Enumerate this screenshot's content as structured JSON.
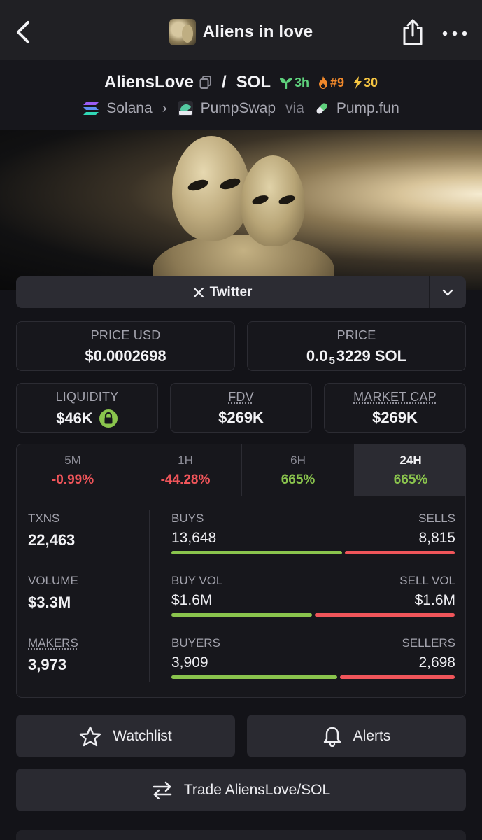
{
  "nav": {
    "title": "Aliens in love",
    "back_icon": "chevron-left-icon",
    "share_icon": "share-icon",
    "more_icon": "more-dots-icon"
  },
  "pair": {
    "base": "AliensLove",
    "slash": "/",
    "quote": "SOL",
    "age": "3h",
    "rank": "#9",
    "boosts": "30",
    "chain": "Solana",
    "dex": "PumpSwap",
    "via": "via",
    "launchpad": "Pump.fun"
  },
  "links": {
    "twitter_label": "Twitter"
  },
  "prices": {
    "price_usd_label": "PRICE USD",
    "price_usd": "$0.0002698",
    "price_label": "PRICE",
    "price_native_prefix": "0.0",
    "price_native_zeros": "5",
    "price_native_suffix": "3229 SOL"
  },
  "metrics": {
    "liquidity_label": "LIQUIDITY",
    "liquidity": "$46K",
    "fdv_label": "FDV",
    "fdv": "$269K",
    "mcap_label": "MARKET CAP",
    "mcap": "$269K"
  },
  "timeframes": [
    {
      "label": "5M",
      "change": "-0.99%",
      "direction": "down"
    },
    {
      "label": "1H",
      "change": "-44.28%",
      "direction": "down"
    },
    {
      "label": "6H",
      "change": "665%",
      "direction": "up"
    },
    {
      "label": "24H",
      "change": "665%",
      "direction": "up",
      "active": true
    }
  ],
  "stats": {
    "txns_label": "TXNS",
    "txns": "22,463",
    "buys_label": "BUYS",
    "buys": "13,648",
    "sells_label": "SELLS",
    "sells": "8,815",
    "buys_fraction": 0.608,
    "volume_label": "VOLUME",
    "volume": "$3.3M",
    "buy_vol_label": "BUY VOL",
    "buy_vol": "$1.6M",
    "sell_vol_label": "SELL VOL",
    "sell_vol": "$1.6M",
    "buy_vol_fraction": 0.5,
    "makers_label": "MAKERS",
    "makers": "3,973",
    "buyers_label": "BUYERS",
    "buyers": "3,909",
    "sellers_label": "SELLERS",
    "sellers": "2,698",
    "buyers_fraction": 0.592
  },
  "actions": {
    "watchlist": "Watchlist",
    "alerts": "Alerts",
    "trade": "Trade AliensLove/SOL"
  },
  "colors": {
    "positive": "#8ac44d",
    "negative": "#f0555a",
    "background": "#131318"
  }
}
